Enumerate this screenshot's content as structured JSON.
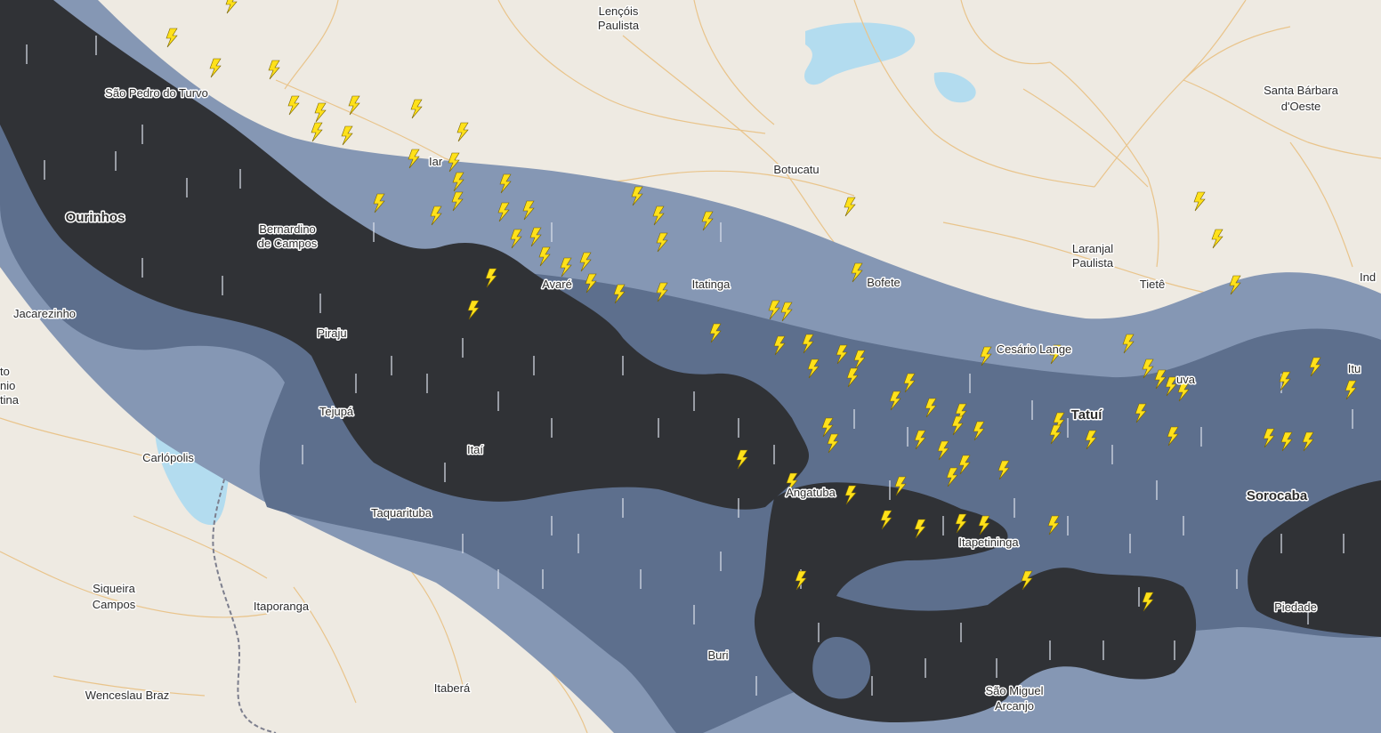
{
  "map": {
    "colors": {
      "land": "#eeeae2",
      "water": "#b3dcef",
      "roads": "#e9c48b",
      "precip_light": "#8597b4",
      "precip_medium": "#5d6f8d",
      "precip_heavy": "#303236",
      "lightning": "#ffe11a"
    },
    "layers": [
      "precipitation",
      "lightning",
      "rain-streaks",
      "city-labels"
    ],
    "icons": [
      "lightning-bolt-icon",
      "rain-streak-icon"
    ],
    "cities": [
      {
        "id": "lencois",
        "lines": [
          "Lençóis",
          "Paulista"
        ]
      },
      {
        "id": "santa-barbara",
        "lines": [
          "Santa Bárbara",
          "d'Oeste"
        ]
      },
      {
        "id": "sao-pedro-do-turvo",
        "lines": [
          "São Pedro do Turvo"
        ]
      },
      {
        "id": "ourinhos",
        "lines": [
          "Ourinhos"
        ]
      },
      {
        "id": "bernardino",
        "lines": [
          "Bernardino",
          "de Campos"
        ]
      },
      {
        "id": "botucatu",
        "lines": [
          "Botucatu"
        ]
      },
      {
        "id": "laranjal",
        "lines": [
          "Laranjal",
          "Paulista"
        ]
      },
      {
        "id": "tiete",
        "lines": [
          "Tietê"
        ]
      },
      {
        "id": "jacarezinho",
        "lines": [
          "Jacarezinho"
        ]
      },
      {
        "id": "piraju",
        "lines": [
          "Piraju"
        ]
      },
      {
        "id": "avare",
        "lines": [
          "Avaré"
        ]
      },
      {
        "id": "itatinga",
        "lines": [
          "Itatinga"
        ]
      },
      {
        "id": "bofete",
        "lines": [
          "Bofete"
        ]
      },
      {
        "id": "cesario-lange",
        "lines": [
          "Cesário Lange"
        ]
      },
      {
        "id": "itu",
        "lines": [
          "Itu"
        ]
      },
      {
        "id": "tejupa",
        "lines": [
          "Tejupá"
        ]
      },
      {
        "id": "tatui",
        "lines": [
          "Tatuí"
        ]
      },
      {
        "id": "itai",
        "lines": [
          "Itaí"
        ]
      },
      {
        "id": "carlopolis",
        "lines": [
          "Carlópolis"
        ]
      },
      {
        "id": "angatuba",
        "lines": [
          "Angatuba"
        ]
      },
      {
        "id": "sorocaba",
        "lines": [
          "Sorocaba"
        ]
      },
      {
        "id": "taquarituba",
        "lines": [
          "Taquarituba"
        ]
      },
      {
        "id": "itapetininga",
        "lines": [
          "Itapetininga"
        ]
      },
      {
        "id": "siqueira",
        "lines": [
          "Siqueira",
          "Campos"
        ]
      },
      {
        "id": "itaporanga",
        "lines": [
          "Itaporanga"
        ]
      },
      {
        "id": "piedade",
        "lines": [
          "Piedade"
        ]
      },
      {
        "id": "buri",
        "lines": [
          "Buri"
        ]
      },
      {
        "id": "wenceslau",
        "lines": [
          "Wenceslau Braz"
        ]
      },
      {
        "id": "itabera",
        "lines": [
          "Itaberá"
        ]
      },
      {
        "id": "sao-miguel",
        "lines": [
          "São Miguel",
          "Arcanjo"
        ]
      },
      {
        "id": "ind-partial",
        "lines": [
          "Ind"
        ]
      },
      {
        "id": "iar-partial",
        "lines": [
          "Iar"
        ]
      },
      {
        "id": "left-fragment",
        "lines": [
          "to",
          "nio",
          "tina"
        ]
      },
      {
        "id": "boituva-partial",
        "lines": [
          "uva"
        ]
      }
    ]
  }
}
